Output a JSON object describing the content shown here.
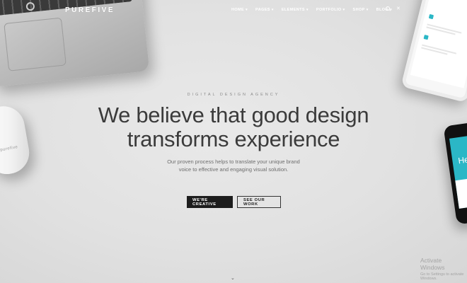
{
  "brand": {
    "logo": "PUREFIVE"
  },
  "nav": {
    "items": [
      {
        "label": "HOME"
      },
      {
        "label": "PAGES"
      },
      {
        "label": "ELEMENTS"
      },
      {
        "label": "PORTFOLIO"
      },
      {
        "label": "SHOP"
      },
      {
        "label": "BLOG"
      }
    ],
    "icons": [
      "search-icon",
      "close-icon"
    ]
  },
  "hero": {
    "tagline": "DIGITAL DESIGN AGENCY",
    "headline_line1": "We believe that good design",
    "headline_line2": "transforms experience",
    "subtext_line1": "Our proven process helps to translate your unique brand",
    "subtext_line2": "voice to effective and engaging visual solution.",
    "primary_button": "WE'RE CREATIVE",
    "secondary_button": "SEE OUR WORK"
  },
  "decor": {
    "mouse_label": "purefive",
    "phone_text": "He"
  },
  "watermark": {
    "title": "Activate Windows",
    "subtitle": "Go to Settings to activate Windows."
  },
  "colors": {
    "accent": "#2bb7c6",
    "dark_button": "#1d1d1d",
    "background": "#e3e3e3"
  }
}
